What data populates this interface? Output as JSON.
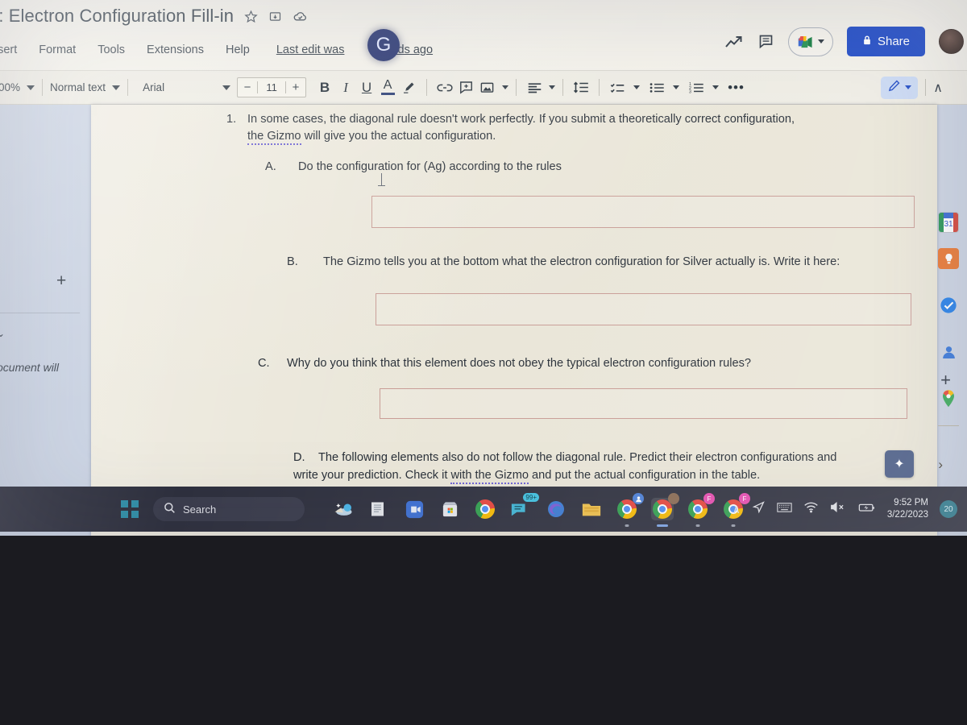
{
  "app": {
    "doc_title": "o: Electron Configuration Fill-in",
    "title_icons": [
      "star-icon",
      "move-to-folder-icon",
      "cloud-saved-icon"
    ],
    "menus": [
      "Insert",
      "Format",
      "Tools",
      "Extensions",
      "Help"
    ],
    "last_edit": "Last edit was ",
    "last_edit_tail": "nds ago",
    "spinner_glyph": "G",
    "share_label": "Share",
    "accent_blue": "#1b47c4",
    "top_right_icons": [
      "activity-dashboard-icon",
      "comment-history-icon",
      "meet-icon",
      "share-icon",
      "account-avatar"
    ]
  },
  "toolbar": {
    "zoom": "00%",
    "style": "Normal text",
    "font": "Arial",
    "font_size": "11",
    "decrease": "−",
    "increase": "+",
    "bold": "B",
    "italic": "I",
    "underline": "U",
    "text_color": "A",
    "more": "•••",
    "collapse": "∧",
    "icons": [
      "highlight-icon",
      "insert-link-icon",
      "add-comment-icon",
      "insert-image-icon",
      "align-icon",
      "line-spacing-icon",
      "checklist-icon",
      "bulleted-list-icon",
      "numbered-list-icon",
      "more-options-icon",
      "editing-mode-pencil-icon",
      "collapse-toolbar-icon"
    ]
  },
  "left_rail": {
    "plus": "+",
    "caret": "⌄",
    "clipped_text": "ocument will"
  },
  "side_panel": {
    "items": [
      {
        "name": "calendar",
        "label": "31"
      },
      {
        "name": "keep",
        "label": "●"
      },
      {
        "name": "tasks",
        "label": "✓"
      },
      {
        "name": "contacts",
        "label": "●"
      },
      {
        "name": "maps",
        "label": "●"
      }
    ],
    "add_label": "+",
    "expand_label": "›",
    "explore_label": "✦"
  },
  "document": {
    "q1": {
      "number": "1.",
      "text_a": "In some cases, the diagonal rule doesn't work perfectly. If you submit a theoretically correct configuration,",
      "squiggle": "the Gizmo",
      "text_b": " will give you the actual configuration."
    },
    "parts": [
      {
        "label": "A.",
        "text": "Do the configuration for (Ag) according to the rules",
        "answer_value": "",
        "answer_placeholder": ""
      },
      {
        "label": "B.",
        "text": "The Gizmo tells you at the bottom what the electron configuration for Silver actually is. Write it here:",
        "answer_value": "",
        "answer_placeholder": ""
      },
      {
        "label": "C.",
        "text": "Why do you think that this element does not obey the typical electron configuration rules?",
        "answer_value": "",
        "answer_placeholder": ""
      },
      {
        "label": "D.",
        "text": "The following elements also do not follow the diagonal rule.  Predict their electron configurations and",
        "text_line2_pre": "write your prediction.  Check it ",
        "text_line2_squiggle": "with the Gizmo",
        "text_line2_post": " and put the actual configuration in the table."
      }
    ],
    "answer_box_border": "#c79a93",
    "page_background": "#e9e5d7"
  },
  "taskbar": {
    "search_placeholder": "Search",
    "start_label": "start-button",
    "apps": [
      {
        "name": "widgets-weather",
        "badge": ""
      },
      {
        "name": "file-explorer-docs",
        "badge": ""
      },
      {
        "name": "google-meet",
        "badge": ""
      },
      {
        "name": "microsoft-store",
        "badge": ""
      },
      {
        "name": "google-chrome",
        "badge": ""
      },
      {
        "name": "teams-chat",
        "badge": "99+"
      },
      {
        "name": "microsoft-edge",
        "badge": ""
      },
      {
        "name": "file-explorer",
        "badge": ""
      },
      {
        "name": "chrome-profile-1",
        "badge": "●"
      },
      {
        "name": "chrome-profile-2",
        "badge": "●"
      },
      {
        "name": "chrome-profile-f1",
        "badge": "F"
      },
      {
        "name": "chrome-profile-f2",
        "badge": "F"
      }
    ],
    "tray": {
      "hidden_icons": "∧",
      "location_icon": "location-arrow-icon",
      "keyboard_icon": "touch-keyboard-icon",
      "wifi_icon": "wifi-icon",
      "volume_icon": "volume-muted-icon",
      "battery_icon": "battery-charging-icon",
      "time": "9:52 PM",
      "date": "3/22/2023",
      "notification_count": "20"
    }
  }
}
